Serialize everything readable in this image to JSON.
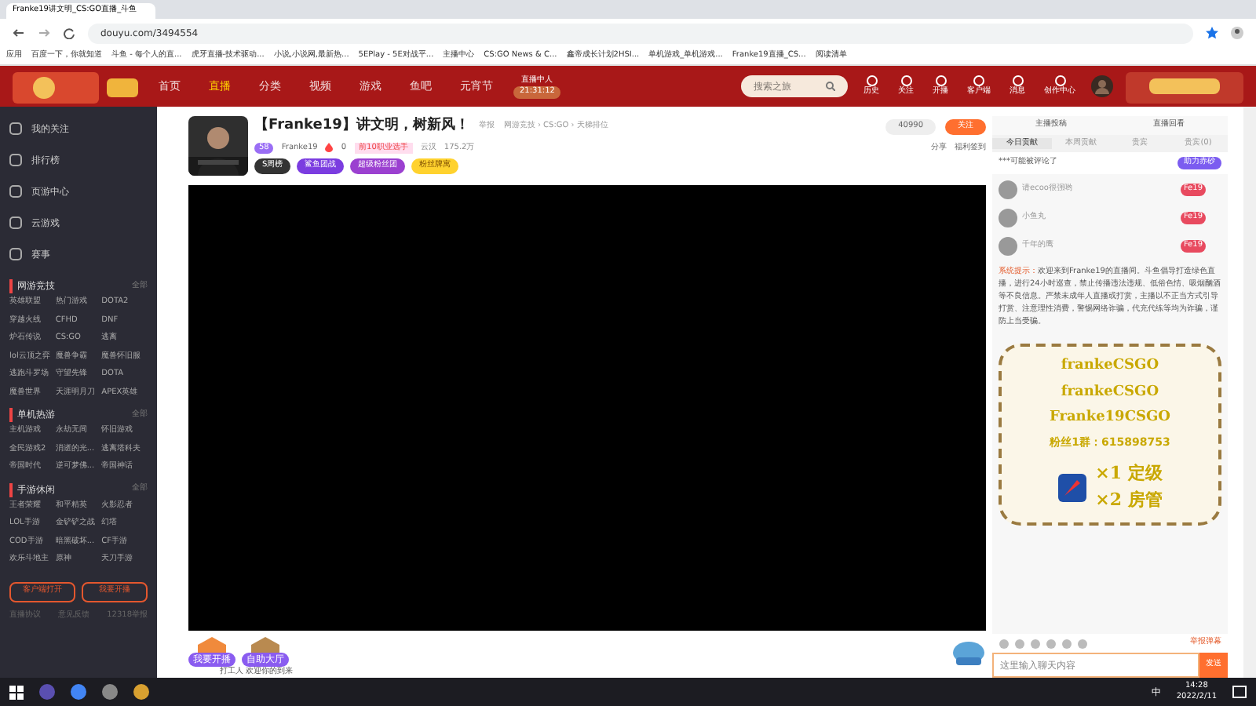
{
  "browser": {
    "tab_title": "Franke19讲文明_CS:GO直播_斗鱼",
    "url": "douyu.com/3494554",
    "bookmarks": [
      "应用",
      "百度一下，你就知道",
      "斗鱼 - 每个人的直...",
      "虎牙直播-技术驱动...",
      "小说,小说网,最新热...",
      "5EPlay - 5E对战平...",
      "主播中心",
      "CS:GO News & C...",
      "鑫帝成长计划2HSI...",
      "单机游戏_单机游戏...",
      "Franke19直播_CS...",
      "阅读清单"
    ]
  },
  "header": {
    "nav": [
      {
        "label": "首页",
        "selected": false
      },
      {
        "label": "直播",
        "selected": true
      },
      {
        "label": "分类",
        "selected": false
      },
      {
        "label": "视频",
        "selected": false
      },
      {
        "label": "游戏",
        "selected": false
      },
      {
        "label": "鱼吧",
        "selected": false
      },
      {
        "label": "元宵节",
        "selected": false
      }
    ],
    "countdown_label": "直播中人",
    "countdown": "21:31:12",
    "search": {
      "placeholder": "搜索之旅"
    },
    "actions": [
      "历史",
      "关注",
      "开播",
      "客户端",
      "消息",
      "创作中心"
    ]
  },
  "sidebar": {
    "items": [
      "我的关注",
      "排行榜",
      "页游中心",
      "云游戏",
      "赛事"
    ],
    "sections": [
      {
        "title": "网游竞技",
        "more": "全部",
        "games": [
          "英雄联盟",
          "热门游戏",
          "DOTA2",
          "穿越火线",
          "CFHD",
          "DNF",
          "炉石传说",
          "CS:GO",
          "逃离",
          "lol云顶之弈",
          "魔兽争霸",
          "魔兽怀旧服",
          "逃跑斗罗场",
          "守望先锋",
          "DOTA",
          "魔兽世界",
          "天涯明月刀",
          "APEX英雄"
        ]
      },
      {
        "title": "单机热游",
        "more": "全部",
        "games": [
          "主机游戏",
          "永劫无间",
          "怀旧游戏",
          "全民游戏2",
          "消逝的光...",
          "逃离塔科夫",
          "帝国时代",
          "逆可梦佛...",
          "帝国神话"
        ]
      },
      {
        "title": "手游休闲",
        "more": "全部",
        "games": [
          "王者荣耀",
          "和平精英",
          "火影忍者",
          "LOL手游",
          "金铲铲之战",
          "幻塔",
          "COD手游",
          "暗黑破坏...",
          "CF手游",
          "欢乐斗地主",
          "原神",
          "天刀手游"
        ]
      }
    ],
    "buttons": [
      "客户端打开",
      "我要开播"
    ],
    "footer": [
      "直播协议",
      "意见反馈",
      "12318举报"
    ]
  },
  "room": {
    "title": "【Franke19】讲文明，树新风！",
    "report": "举报",
    "category": "网游竞技 › CS:GO › 天梯排位",
    "level": "58",
    "streamer": "Franke19",
    "hot": "0",
    "badge": "前10职业选手",
    "location": "云汉",
    "viewers": "175.2万",
    "follow_count": "40990",
    "follow": "关注",
    "share": "分享",
    "benefit": "福利签到",
    "chips": [
      "S周榜",
      "鲨鱼团战",
      "超级粉丝团",
      "粉丝牌寓"
    ]
  },
  "gift_bar": {
    "items": [
      "我要开播",
      "自助大厅"
    ],
    "notice": "打工人 欢迎你的到来"
  },
  "chat": {
    "tabs": [
      "主播投稿",
      "直播回看"
    ],
    "rank_tabs": [
      {
        "label": "今日贡献",
        "selected": true
      },
      {
        "label": "本周贡献",
        "selected": false
      },
      {
        "label": "贵宾",
        "selected": false
      },
      {
        "label": "贵宾(0)",
        "selected": false
      }
    ],
    "top_message": "***可能被评论了",
    "top_button": "助力赤砂",
    "messages": [
      {
        "user": "请ecoo很强哟",
        "badge": "Fe19"
      },
      {
        "user": "小鱼丸",
        "badge": "Fe19"
      },
      {
        "user": "千年的鹰",
        "badge": "Fe19"
      }
    ],
    "system_label": "系统提示：",
    "system_text": "欢迎来到Franke19的直播间。斗鱼倡导打造绿色直播，进行24小时巡查，禁止传播违法违规、低俗色情、吸烟酗酒等不良信息。严禁未成年人直播或打赏，主播以不正当方式引导打赏、注意理性消费，警惕网络诈骗，代充代练等均为诈骗，谨防上当受骗。",
    "overlay": {
      "handles": [
        "frankeCSGO",
        "frankeCSGO",
        "Franke19CSGO"
      ],
      "qq": "粉丝1群：615898753",
      "lines": [
        "×1 定级",
        "×2 房管"
      ]
    },
    "report": "举报弹幕",
    "input": {
      "placeholder": "这里输入聊天内容"
    },
    "send": "发送"
  },
  "taskbar": {
    "ime": "中",
    "time": "14:28",
    "date": "2022/2/11"
  }
}
